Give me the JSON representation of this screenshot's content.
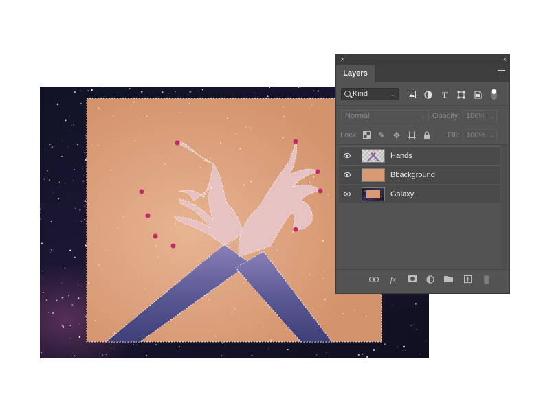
{
  "panel": {
    "close_glyph": "×",
    "collapse_glyph": "‹‹",
    "title": "Layers",
    "menu_icon": "hamburger-icon"
  },
  "filter": {
    "kind_label": "Kind",
    "icons": [
      "image-filter-icon",
      "adjustment-filter-icon",
      "type-filter-icon",
      "shape-filter-icon",
      "smart-object-filter-icon"
    ],
    "toggle_on": true
  },
  "blend": {
    "mode": "Normal",
    "opacity_label": "Opacity:",
    "opacity_value": "100%",
    "lock_label": "Lock:",
    "fill_label": "Fill:",
    "fill_value": "100%"
  },
  "lock_icons": [
    "lock-transparent-pixels-icon",
    "lock-image-pixels-icon",
    "lock-position-icon",
    "lock-artboard-icon",
    "lock-all-icon"
  ],
  "layers": [
    {
      "name": "Hands",
      "visible": true,
      "thumbnail": "transparent"
    },
    {
      "name": "Bbackground",
      "visible": true,
      "thumbnail": "#d99a73"
    },
    {
      "name": "Galaxy",
      "visible": true,
      "thumbnail": "galaxy"
    }
  ],
  "bottom_icons": [
    "link-layers-icon",
    "fx-icon",
    "add-mask-icon",
    "new-adjustment-icon",
    "new-group-icon",
    "new-layer-icon",
    "delete-layer-icon"
  ],
  "colors": {
    "panel_bg": "#535353",
    "background_layer": "#d99a73",
    "galaxy": "#1c1633",
    "nail_polish": "#c22a6a",
    "skin": "#e9c4c4"
  }
}
